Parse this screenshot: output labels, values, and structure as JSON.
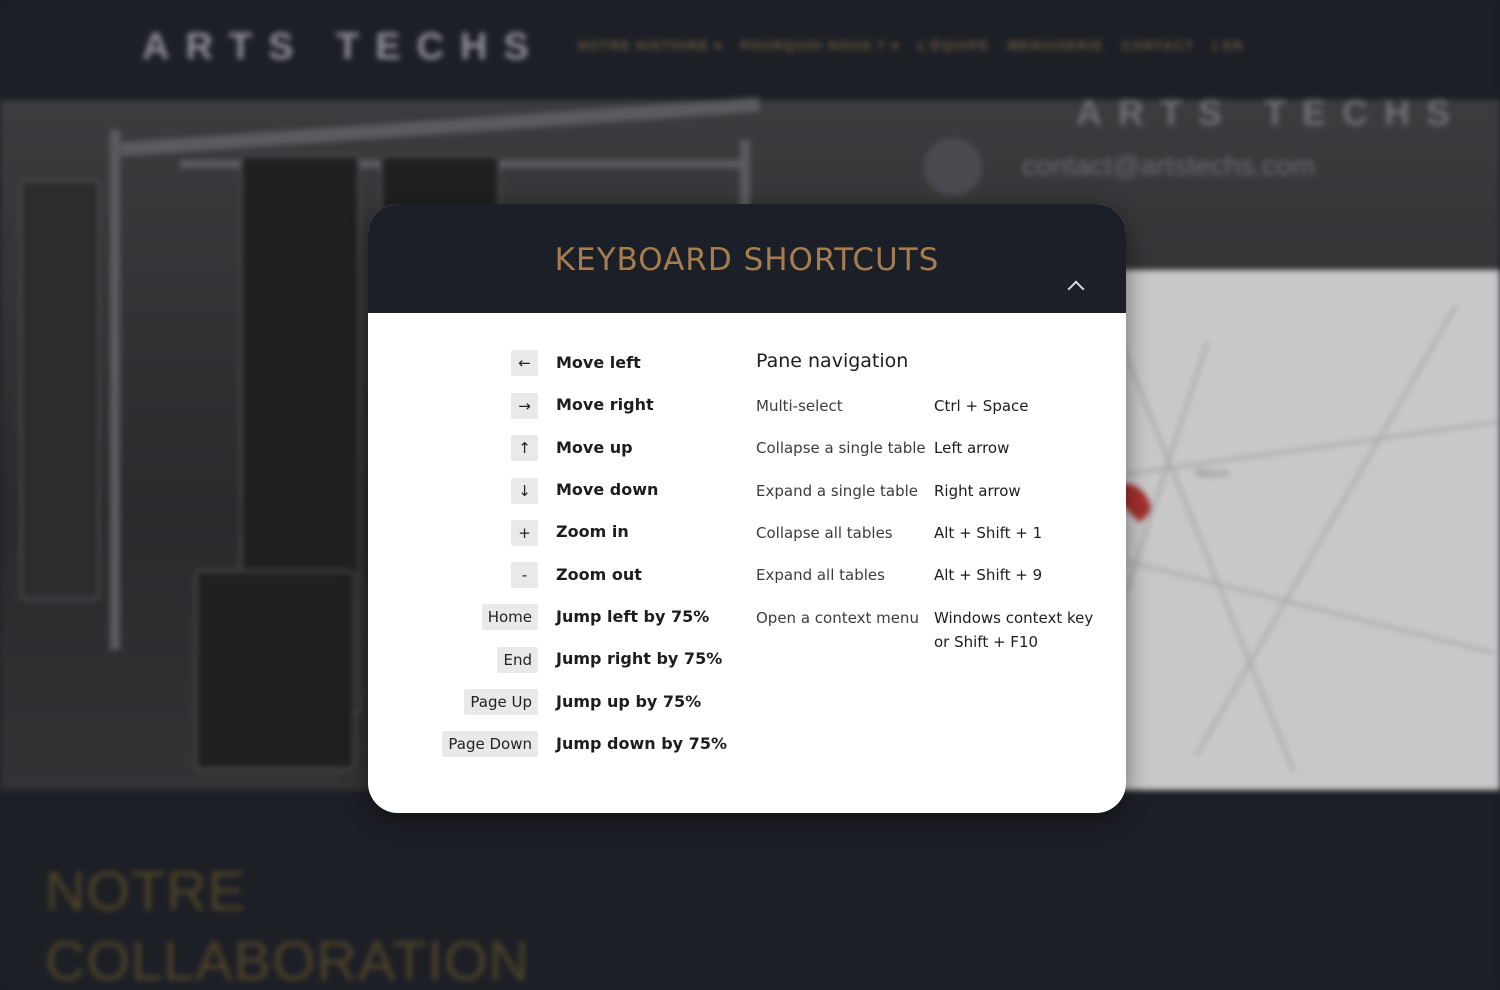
{
  "background": {
    "brand_logo": "ARTS TECHS",
    "nav": [
      "NOTRE HISTOIRE ▾",
      "POURQUOI NOUS ? ▾",
      "L'ÉQUIPE",
      "MENUISERIE",
      "CONTACT",
      "| EN"
    ],
    "contact_email": "contact@artstechs.com",
    "section_heading_line1": "NOTRE",
    "section_heading_line2": "COLLABORATION",
    "map_labels": [
      "Wavre"
    ]
  },
  "modal": {
    "title": "KEYBOARD SHORTCUTS",
    "close_icon": "chevron-up-icon",
    "map_shortcuts": [
      {
        "key": "←",
        "label": "Move left"
      },
      {
        "key": "→",
        "label": "Move right"
      },
      {
        "key": "↑",
        "label": "Move up"
      },
      {
        "key": "↓",
        "label": "Move down"
      },
      {
        "key": "+",
        "label": "Zoom in"
      },
      {
        "key": "-",
        "label": "Zoom out"
      },
      {
        "key": "Home",
        "label": "Jump left by 75%"
      },
      {
        "key": "End",
        "label": "Jump right by 75%"
      },
      {
        "key": "Page Up",
        "label": "Jump up by 75%"
      },
      {
        "key": "Page Down",
        "label": "Jump down by 75%"
      }
    ],
    "pane_title": "Pane navigation",
    "pane_shortcuts": [
      {
        "label": "Multi-select",
        "keys": "Ctrl + Space"
      },
      {
        "label": "Collapse a single table",
        "keys": "Left arrow"
      },
      {
        "label": "Expand a single table",
        "keys": "Right arrow"
      },
      {
        "label": "Collapse all tables",
        "keys": "Alt + Shift + 1"
      },
      {
        "label": "Expand all tables",
        "keys": "Alt + Shift + 9"
      },
      {
        "label": "Open a context menu",
        "keys": "Windows context key or Shift + F10"
      }
    ]
  }
}
